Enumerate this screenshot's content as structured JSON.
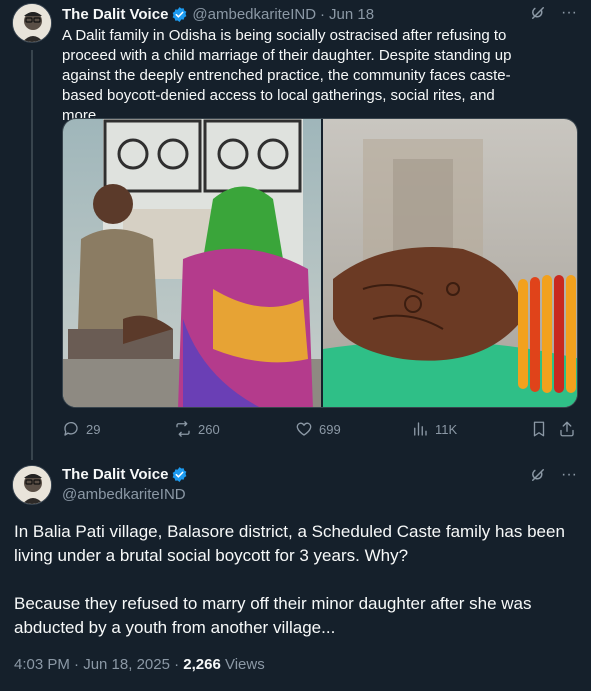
{
  "tweet1": {
    "author_name": "The Dalit Voice",
    "handle": "@ambedkariteIND",
    "separator": "·",
    "date": "Jun 18",
    "text": "A Dalit family in Odisha is being socially ostracised after refusing to proceed with a child marriage of their daughter. Despite standing up against the deeply entrenched practice, the community faces caste-based boycott-denied access to local gatherings, social rites, and more..",
    "more_icon": "···",
    "stats": {
      "replies": "29",
      "reposts": "260",
      "likes": "699",
      "views": "11K"
    }
  },
  "tweet2": {
    "author_name": "The Dalit Voice",
    "handle": "@ambedkariteIND",
    "more_icon": "···",
    "paragraph1": "In Balia Pati village, Balasore district, a Scheduled Caste family has been living under a brutal social boycott for 3 years. Why?",
    "paragraph2": "Because they refused to marry off their minor daughter after she was abducted by a youth from another village...",
    "time": "4:03 PM · Jun 18, 2025 · ",
    "views_count": "2,266",
    "views_label": " Views"
  },
  "colors": {
    "background": "#15202b",
    "text": "#f7f9f9",
    "muted": "#8b98a5",
    "verified": "#1d9bf0",
    "border": "#38444d"
  },
  "icons": [
    "verified-badge-icon",
    "grok-icon",
    "reply-icon",
    "repost-icon",
    "like-icon",
    "views-icon",
    "bookmark-icon",
    "share-icon"
  ]
}
